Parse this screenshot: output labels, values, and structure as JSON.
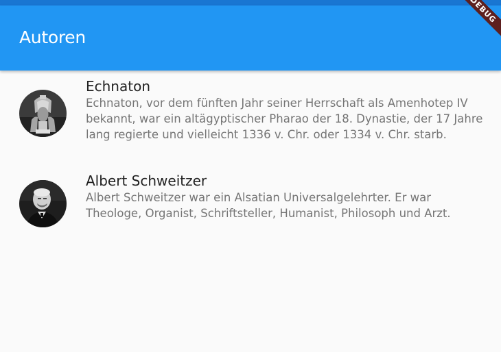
{
  "app_bar": {
    "title": "Autoren",
    "background_color": "#2196f3"
  },
  "debug_banner": {
    "label": "DEBUG"
  },
  "authors": [
    {
      "name": "Echnaton",
      "description": "Echnaton, vor dem fünften Jahr seiner Herrschaft als Amenhotep IV bekannt, war ein altägyptischer Pharao der 18. Dynastie, der 17 Jahre lang regierte und vielleicht 1336 v. Chr. oder 1334 v. Chr. starb.",
      "avatar_icon": "pharaoh-bust-avatar"
    },
    {
      "name": "Albert Schweitzer",
      "description": "Albert Schweitzer war ein Alsatian Universalgelehrter. Er war Theologe, Organist, Schriftsteller, Humanist, Philosoph und Arzt.",
      "avatar_icon": "portrait-photo-avatar"
    }
  ]
}
